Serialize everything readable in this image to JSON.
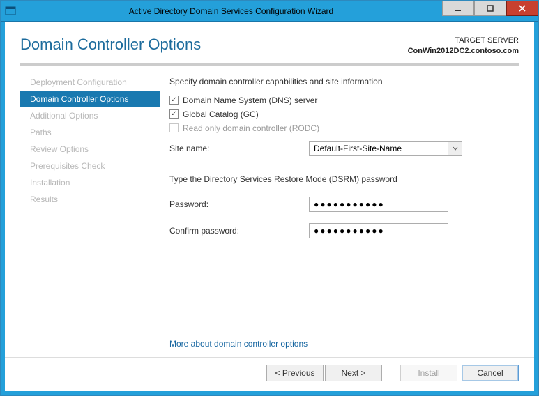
{
  "window": {
    "title": "Active Directory Domain Services Configuration Wizard"
  },
  "header": {
    "page_title": "Domain Controller Options",
    "target_label": "TARGET SERVER",
    "target_name": "ConWin2012DC2.contoso.com"
  },
  "sidebar": {
    "items": [
      {
        "label": "Deployment Configuration",
        "active": false
      },
      {
        "label": "Domain Controller Options",
        "active": true
      },
      {
        "label": "Additional Options",
        "active": false
      },
      {
        "label": "Paths",
        "active": false
      },
      {
        "label": "Review Options",
        "active": false
      },
      {
        "label": "Prerequisites Check",
        "active": false
      },
      {
        "label": "Installation",
        "active": false
      },
      {
        "label": "Results",
        "active": false
      }
    ]
  },
  "main": {
    "capabilities_label": "Specify domain controller capabilities and site information",
    "checkbox_dns": {
      "label": "Domain Name System (DNS) server",
      "checked": true,
      "enabled": true
    },
    "checkbox_gc": {
      "label": "Global Catalog (GC)",
      "checked": true,
      "enabled": true
    },
    "checkbox_rodc": {
      "label": "Read only domain controller (RODC)",
      "checked": false,
      "enabled": false
    },
    "site_name_label": "Site name:",
    "site_name_value": "Default-First-Site-Name",
    "dsrm_label": "Type the Directory Services Restore Mode (DSRM) password",
    "password_label": "Password:",
    "password_value": "●●●●●●●●●●●",
    "confirm_label": "Confirm password:",
    "confirm_value": "●●●●●●●●●●●",
    "more_link": "More about domain controller options"
  },
  "footer": {
    "previous": "< Previous",
    "next": "Next >",
    "install": "Install",
    "cancel": "Cancel"
  }
}
